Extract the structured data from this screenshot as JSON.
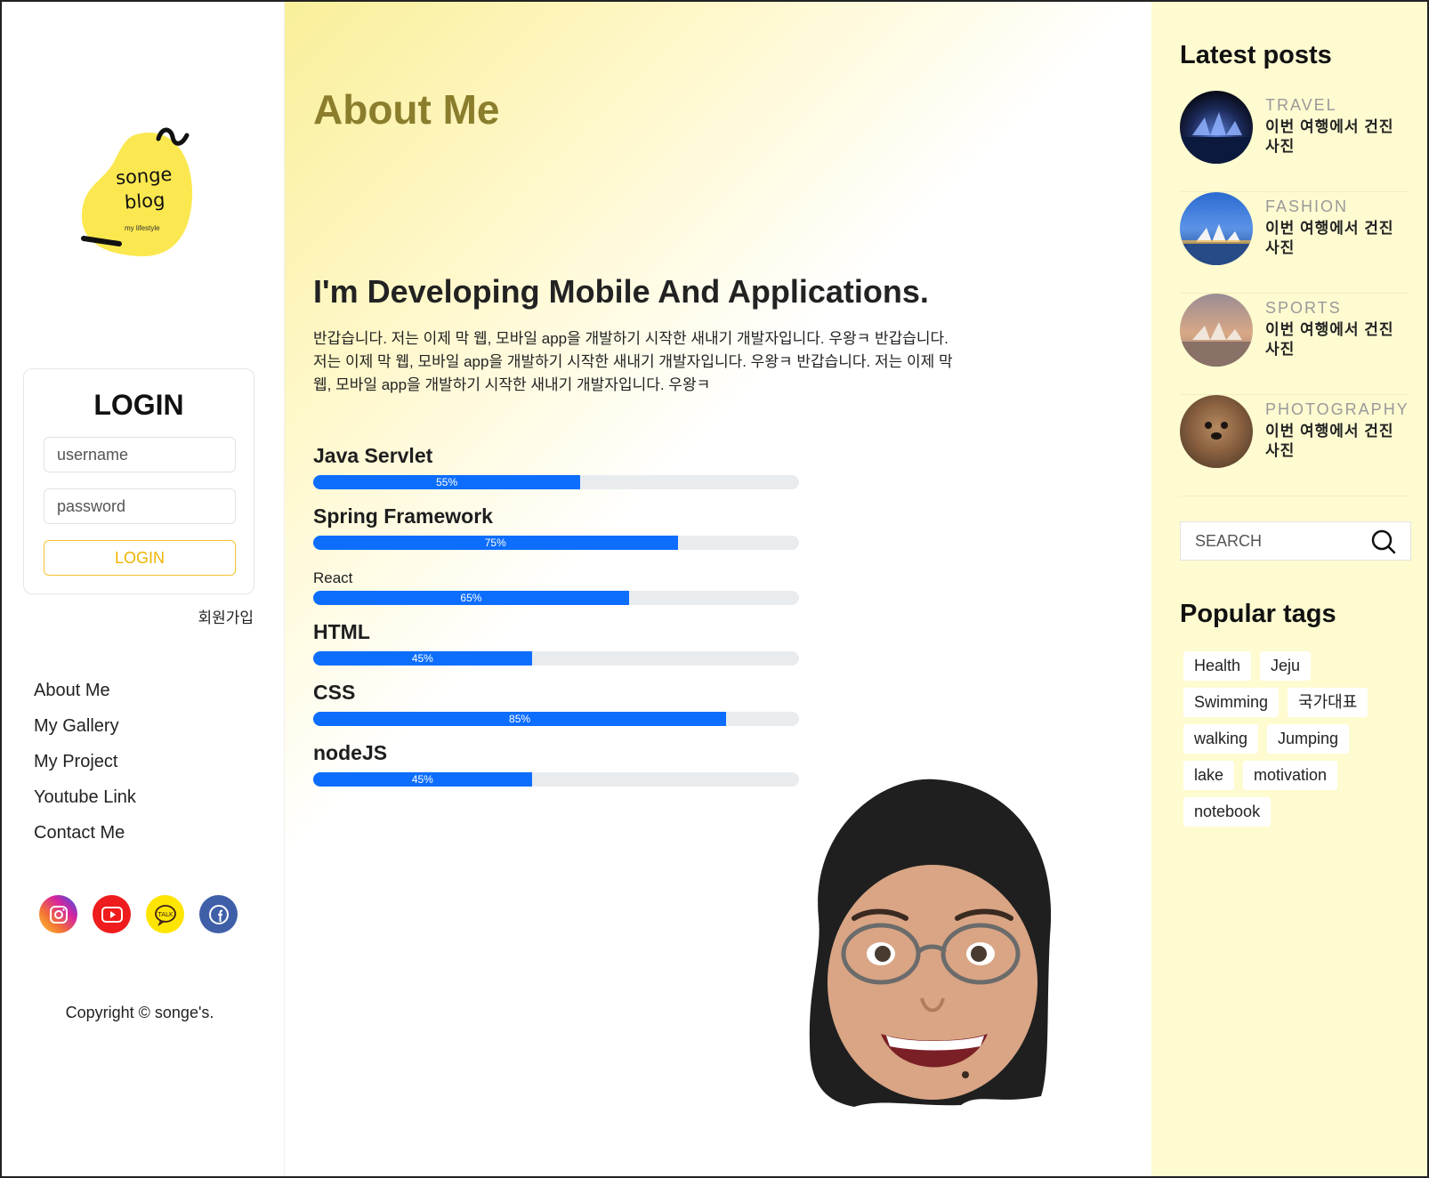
{
  "sidebar": {
    "logo": {
      "line1": "songe",
      "line2": "blog",
      "tagline": "my lifestyle"
    },
    "login": {
      "title": "LOGIN",
      "username_placeholder": "username",
      "password_placeholder": "password",
      "button_label": "LOGIN",
      "signup_label": "회원가입"
    },
    "nav": [
      "About Me",
      "My Gallery",
      "My Project",
      "Youtube Link",
      "Contact Me"
    ],
    "social": [
      {
        "icon": "instagram-icon",
        "color": "#d6249f"
      },
      {
        "icon": "youtube-icon",
        "color": "#ff0000"
      },
      {
        "icon": "kakaotalk-icon",
        "color": "#fee500"
      },
      {
        "icon": "facebook-icon",
        "color": "#3b5998"
      }
    ],
    "copyright": "Copyright © songe's."
  },
  "main": {
    "title": "About Me",
    "headline": "I'm Developing Mobile And Applications.",
    "intro": "반갑습니다. 저는 이제 막 웹, 모바일 app을 개발하기 시작한 새내기 개발자입니다. 우왕ㅋ 반갑습니다. 저는 이제 막 웹, 모바일 app을 개발하기 시작한 새내기 개발자입니다. 우왕ㅋ 반갑습니다. 저는 이제 막 웹, 모바일 app을 개발하기 시작한 새내기 개발자입니다. 우왕ㅋ",
    "skills": [
      {
        "name": "Java Servlet",
        "label": "55%",
        "percent": 55
      },
      {
        "name": "Spring Framework",
        "label": "75%",
        "percent": 75
      },
      {
        "name": "React",
        "label": "65%",
        "percent": 65
      },
      {
        "name": "HTML",
        "label": "45%",
        "percent": 45
      },
      {
        "name": "CSS",
        "label": "85%",
        "percent": 85
      },
      {
        "name": "nodeJS",
        "label": "45%",
        "percent": 45
      }
    ],
    "progress_color": "#0d6efd"
  },
  "right": {
    "latest_title": "Latest posts",
    "posts": [
      {
        "category": "TRAVEL",
        "title": "이번 여행에서 건진 사진"
      },
      {
        "category": "FASHION",
        "title": "이번 여행에서 건진 사진"
      },
      {
        "category": "SPORTS",
        "title": "이번 여행에서 건진 사진"
      },
      {
        "category": "PHOTOGRAPHY",
        "title": "이번 여행에서 건진 사진"
      }
    ],
    "search_placeholder": "SEARCH",
    "tags_title": "Popular tags",
    "tags": [
      "Health",
      "Jeju",
      "Swimming",
      "국가대표",
      "walking",
      "Jumping",
      "lake",
      "motivation",
      "notebook"
    ]
  },
  "colors": {
    "accent": "#f0b400",
    "title": "#8a7d2c",
    "right_bg": "#fefbd1"
  }
}
